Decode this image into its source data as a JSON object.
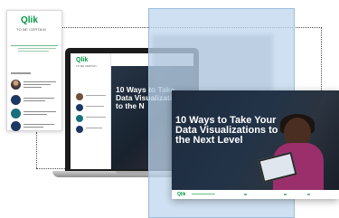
{
  "brand": {
    "logo": "Qlik",
    "logo_mark": "Q",
    "tagline": "TO BE CERTAIN"
  },
  "ebook": {
    "title": "10 Ways to Take Your Data Visualizations to the Next Level",
    "laptop_title_partial": "10 Ways to Take Data Visualizations to the N"
  },
  "colors": {
    "brand_green": "#009845",
    "accent_blue_panel": "#bed6ec",
    "navy": "#1d3764"
  }
}
